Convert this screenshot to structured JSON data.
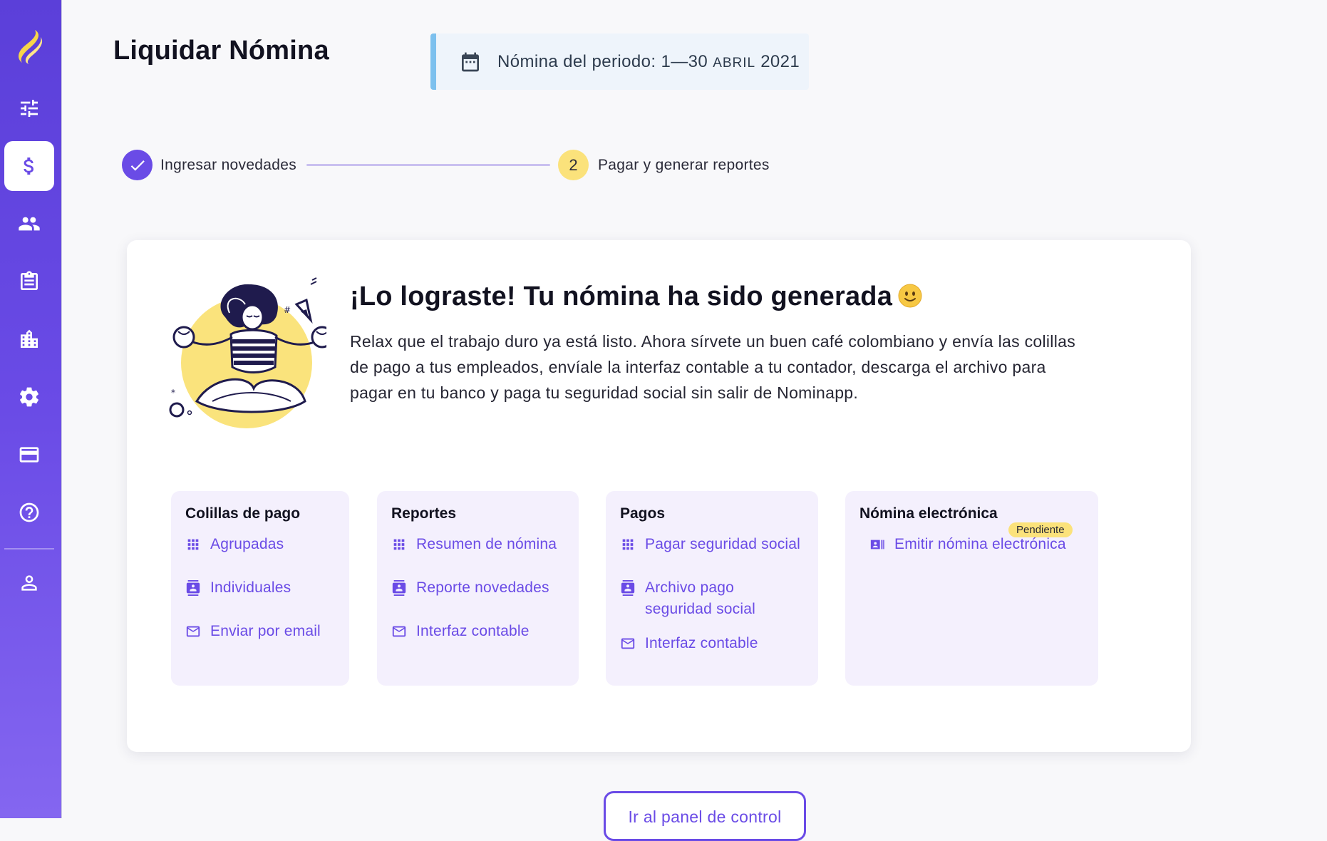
{
  "header": {
    "title": "Liquidar Nómina",
    "period_prefix": "Nómina del periodo: 1—30",
    "period_month": "ABRIL",
    "period_year": "2021"
  },
  "stepper": {
    "step1_label": "Ingresar novedades",
    "step2_number": "2",
    "step2_label": "Pagar y generar reportes"
  },
  "success": {
    "title": "¡Lo lograste! Tu nómina ha sido generada",
    "description": "Relax que el trabajo duro ya está listo. Ahora sírvete un buen café colombiano y envía las colillas de pago a tus empleados, envíale la interfaz contable a tu contador, descarga el archivo para pagar en tu banco y paga tu seguridad social sin salir de Nominapp."
  },
  "cards": {
    "colillas": {
      "title": "Colillas de pago",
      "links": [
        "Agrupadas",
        "Individuales",
        "Enviar por email"
      ]
    },
    "reportes": {
      "title": "Reportes",
      "links": [
        "Resumen de nómina",
        "Reporte novedades",
        "Interfaz contable"
      ]
    },
    "pagos": {
      "title": "Pagos",
      "links": [
        "Pagar seguridad social",
        "Archivo pago seguridad social",
        "Interfaz contable"
      ]
    },
    "electronica": {
      "title": "Nómina electrónica",
      "badge": "Pendiente",
      "links": [
        "Emitir nómina electrónica"
      ]
    }
  },
  "footer": {
    "panel_button": "Ir al panel de control"
  },
  "colors": {
    "accent": "#6a4be6",
    "sidebar_top": "#5b3fd9",
    "badge": "#fbe27b",
    "period_border": "#7cc0ee"
  }
}
